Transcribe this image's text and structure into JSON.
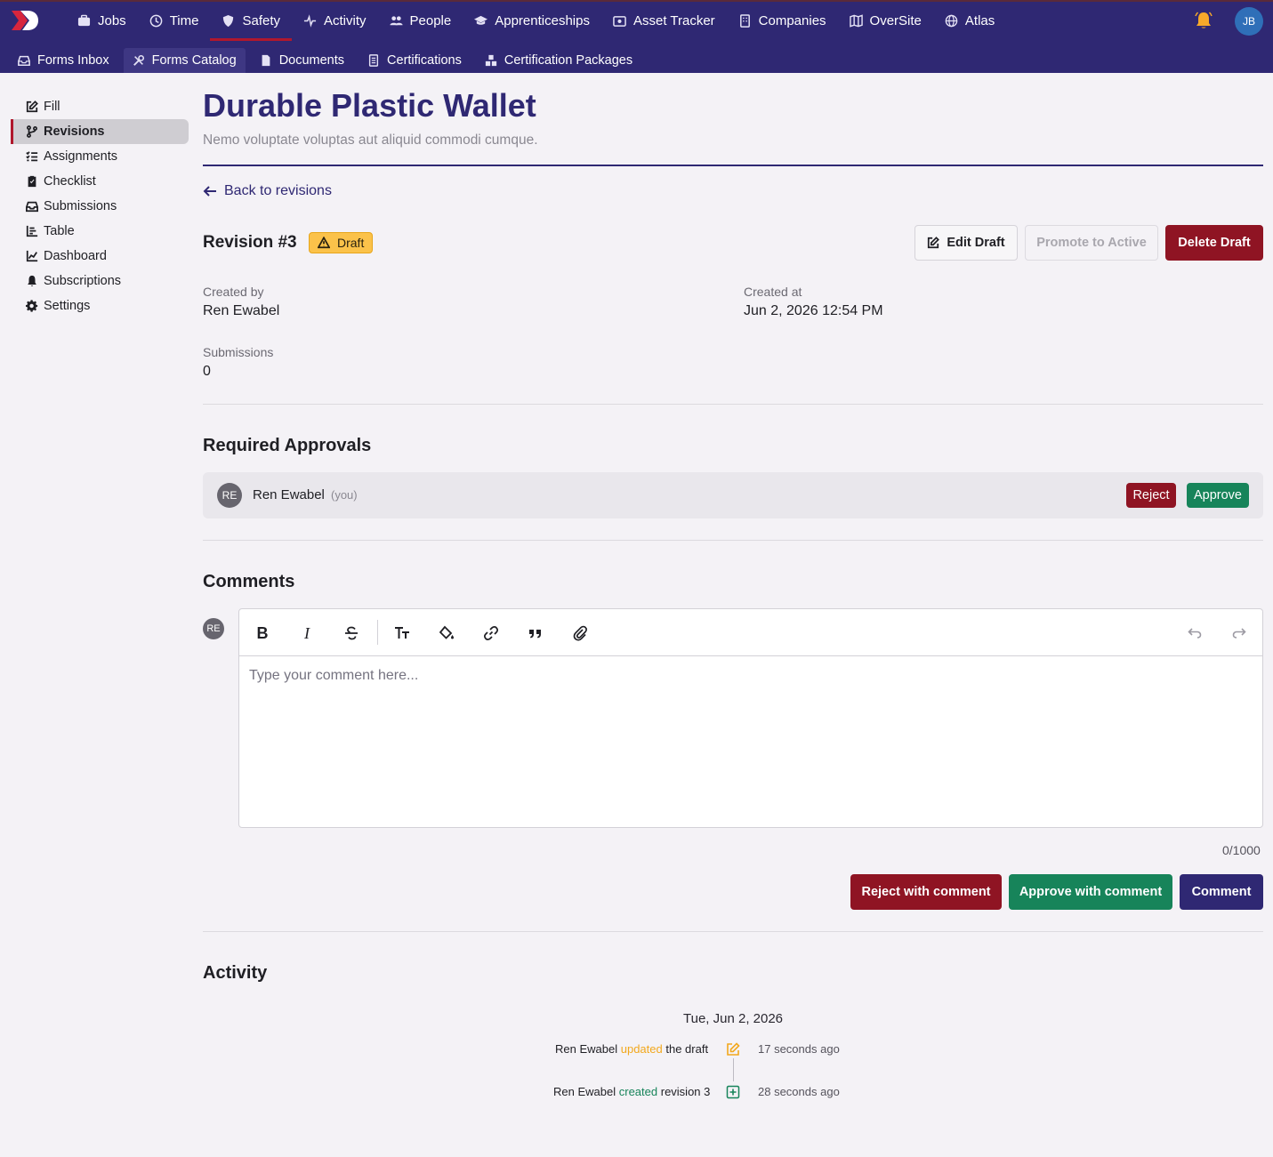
{
  "nav": {
    "items": [
      {
        "label": "Jobs",
        "icon": "briefcase-icon"
      },
      {
        "label": "Time",
        "icon": "clock-icon"
      },
      {
        "label": "Safety",
        "icon": "shield-icon",
        "active": true
      },
      {
        "label": "Activity",
        "icon": "pulse-icon"
      },
      {
        "label": "People",
        "icon": "users-icon"
      },
      {
        "label": "Apprenticeships",
        "icon": "graduation-cap-icon"
      },
      {
        "label": "Asset Tracker",
        "icon": "asset-icon"
      },
      {
        "label": "Companies",
        "icon": "building-icon"
      },
      {
        "label": "OverSite",
        "icon": "map-icon"
      },
      {
        "label": "Atlas",
        "icon": "globe-icon"
      }
    ],
    "user_initials": "JB"
  },
  "subnav": {
    "items": [
      {
        "label": "Forms Inbox",
        "icon": "inbox-icon"
      },
      {
        "label": "Forms Catalog",
        "icon": "tools-icon",
        "active": true
      },
      {
        "label": "Documents",
        "icon": "document-icon"
      },
      {
        "label": "Certifications",
        "icon": "certificate-icon"
      },
      {
        "label": "Certification Packages",
        "icon": "packages-icon"
      }
    ]
  },
  "sidebar": {
    "items": [
      {
        "label": "Fill",
        "icon": "edit-icon"
      },
      {
        "label": "Revisions",
        "icon": "branch-icon",
        "active": true
      },
      {
        "label": "Assignments",
        "icon": "list-check-icon"
      },
      {
        "label": "Checklist",
        "icon": "clipboard-check-icon"
      },
      {
        "label": "Submissions",
        "icon": "inbox-icon"
      },
      {
        "label": "Table",
        "icon": "table-icon"
      },
      {
        "label": "Dashboard",
        "icon": "chart-line-icon"
      },
      {
        "label": "Subscriptions",
        "icon": "bell-icon"
      },
      {
        "label": "Settings",
        "icon": "gear-icon"
      }
    ]
  },
  "page": {
    "title": "Durable Plastic Wallet",
    "subtitle": "Nemo voluptate voluptas aut aliquid commodi cumque.",
    "back_label": "Back to revisions"
  },
  "revision": {
    "title": "Revision #3",
    "status": "Draft",
    "edit_label": "Edit Draft",
    "promote_label": "Promote to Active",
    "delete_label": "Delete Draft",
    "created_by_label": "Created by",
    "created_by": "Ren Ewabel",
    "created_at_label": "Created at",
    "created_at": "Jun 2, 2026 12:54 PM",
    "submissions_label": "Submissions",
    "submissions": "0"
  },
  "approvals": {
    "title": "Required Approvals",
    "rows": [
      {
        "initials": "RE",
        "name": "Ren Ewabel",
        "note": "(you)",
        "reject_label": "Reject",
        "approve_label": "Approve"
      }
    ]
  },
  "comments": {
    "title": "Comments",
    "initials": "RE",
    "placeholder": "Type your comment here...",
    "count": "0/1000",
    "reject_label": "Reject with comment",
    "approve_label": "Approve with comment",
    "comment_label": "Comment"
  },
  "activity": {
    "title": "Activity",
    "date": "Tue, Jun 2, 2026",
    "entries": [
      {
        "actor": "Ren Ewabel",
        "verb": "updated",
        "object": "the draft",
        "time": "17 seconds ago",
        "color": "#f2a81d",
        "icon": "edit-icon"
      },
      {
        "actor": "Ren Ewabel",
        "verb": "created",
        "object": "revision 3",
        "time": "28 seconds ago",
        "color": "#17845a",
        "icon": "plus-square-icon"
      }
    ]
  },
  "colors": {
    "brand": "#2f2873",
    "danger": "#8f1423",
    "success": "#17845a",
    "warning": "#fbc24a"
  }
}
